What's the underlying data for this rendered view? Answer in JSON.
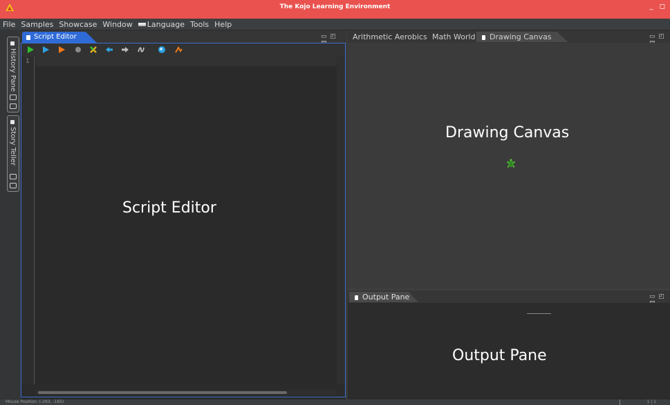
{
  "window": {
    "title": "The Kojo Learning Environment",
    "controls": "_ ◻"
  },
  "menu": [
    {
      "label": "File"
    },
    {
      "label": "Samples"
    },
    {
      "label": "Showcase"
    },
    {
      "label": "Window"
    },
    {
      "label": "Language"
    },
    {
      "label": "Tools"
    },
    {
      "label": "Help"
    }
  ],
  "left_strip": {
    "history_tab": "History Pane",
    "story_tab": "Story Teller"
  },
  "editor": {
    "tab_label": "Script Editor",
    "line_number": "1",
    "placeholder_label": "Script Editor",
    "toolbar": [
      {
        "name": "run-icon",
        "color": "#2fbf2f"
      },
      {
        "name": "run-worksheet-icon",
        "color": "#2f9fe0"
      },
      {
        "name": "trace-icon",
        "color": "#f07a1a"
      },
      {
        "name": "stop-icon",
        "color": "#8a8a8a"
      },
      {
        "name": "clear-icon",
        "color": "#e0b020"
      },
      {
        "name": "undo-icon",
        "color": "#2fa8e8"
      },
      {
        "name": "redo-icon",
        "color": "#bfbfbf"
      },
      {
        "name": "format-icon",
        "color": "#bfbfbf"
      },
      {
        "name": "upload-icon",
        "color": "#2aa0e0"
      },
      {
        "name": "clear-output-icon",
        "color": "#f07a1a"
      }
    ]
  },
  "canvas_pane": {
    "tabs": [
      {
        "label": "Arithmetic Aerobics",
        "active": false
      },
      {
        "label": "Math World",
        "active": false
      },
      {
        "label": "Drawing Canvas",
        "active": true
      }
    ],
    "placeholder_label": "Drawing Canvas"
  },
  "output_pane": {
    "tab_label": "Output Pane",
    "placeholder_label": "Output Pane"
  },
  "status": {
    "mouse_position": "Mouse Position: (-293, -185)",
    "caret_position": "1 | 1"
  },
  "colors": {
    "titlebar": "#e9524e",
    "accent": "#2f6bd7",
    "turtle": "#3a9a2a"
  }
}
